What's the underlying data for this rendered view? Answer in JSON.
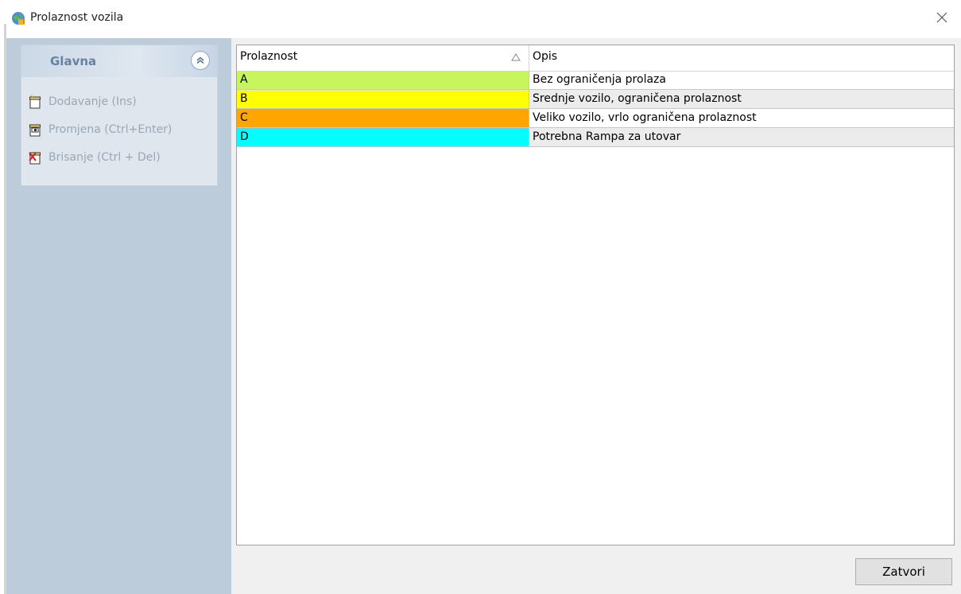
{
  "window": {
    "title": "Prolaznost vozila",
    "app_icon": "globe-app-icon",
    "close_icon": "close-icon"
  },
  "sidebar": {
    "group_title": "Glavna",
    "collapse_icon": "double-chevron-up-icon",
    "items": [
      {
        "label": "Dodavanje (Ins)",
        "icon": "new-document-icon"
      },
      {
        "label": "Promjena (Ctrl+Enter)",
        "icon": "edit-document-icon"
      },
      {
        "label": "Brisanje (Ctrl + Del)",
        "icon": "delete-document-icon"
      }
    ]
  },
  "grid": {
    "columns": [
      {
        "label": "Prolaznost",
        "sort": "ascending"
      },
      {
        "label": "Opis"
      }
    ],
    "rows": [
      {
        "prolaznost": "A",
        "opis": "Bez ograničenja prolaza",
        "color": "#c6f65c"
      },
      {
        "prolaznost": "B",
        "opis": "Srednje vozilo, ograničena prolaznost",
        "color": "#ffff00"
      },
      {
        "prolaznost": "C",
        "opis": "Veliko vozilo, vrlo ograničena prolaznost",
        "color": "#ffa500"
      },
      {
        "prolaznost": "D",
        "opis": "Potrebna Rampa za utovar",
        "color": "#00ffff"
      }
    ]
  },
  "footer": {
    "close_label": "Zatvori"
  }
}
